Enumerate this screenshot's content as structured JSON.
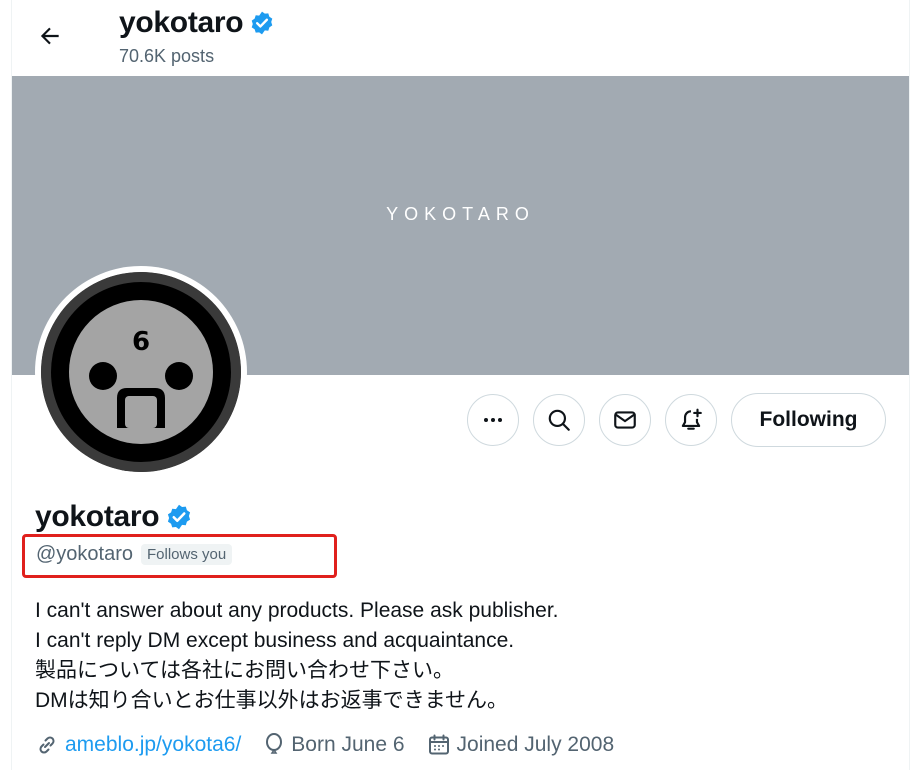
{
  "header": {
    "name": "yokotaro",
    "posts": "70.6K posts"
  },
  "banner": {
    "text": "YOKOTARO"
  },
  "avatar": {
    "number": "6"
  },
  "actions": {
    "following_label": "Following"
  },
  "profile": {
    "name": "yokotaro",
    "handle": "@yokotaro",
    "follows_badge": "Follows you",
    "bio": [
      "I can't answer about any products. Please ask publisher.",
      "I can't reply DM except business and acquaintance.",
      "製品については各社にお問い合わせ下さい。",
      "DMは知り合いとお仕事以外はお返事できません。"
    ],
    "link": "ameblo.jp/yokota6/",
    "born": "Born June 6",
    "joined": "Joined July 2008"
  },
  "colors": {
    "verified": "#1d9bf0",
    "banner": "#a2aab2",
    "highlight": "#e0201d"
  },
  "icons": [
    "back-arrow-icon",
    "verified-badge-icon",
    "more-icon",
    "search-icon",
    "mail-icon",
    "notification-bell-plus-icon",
    "link-icon",
    "balloon-icon",
    "calendar-icon"
  ]
}
